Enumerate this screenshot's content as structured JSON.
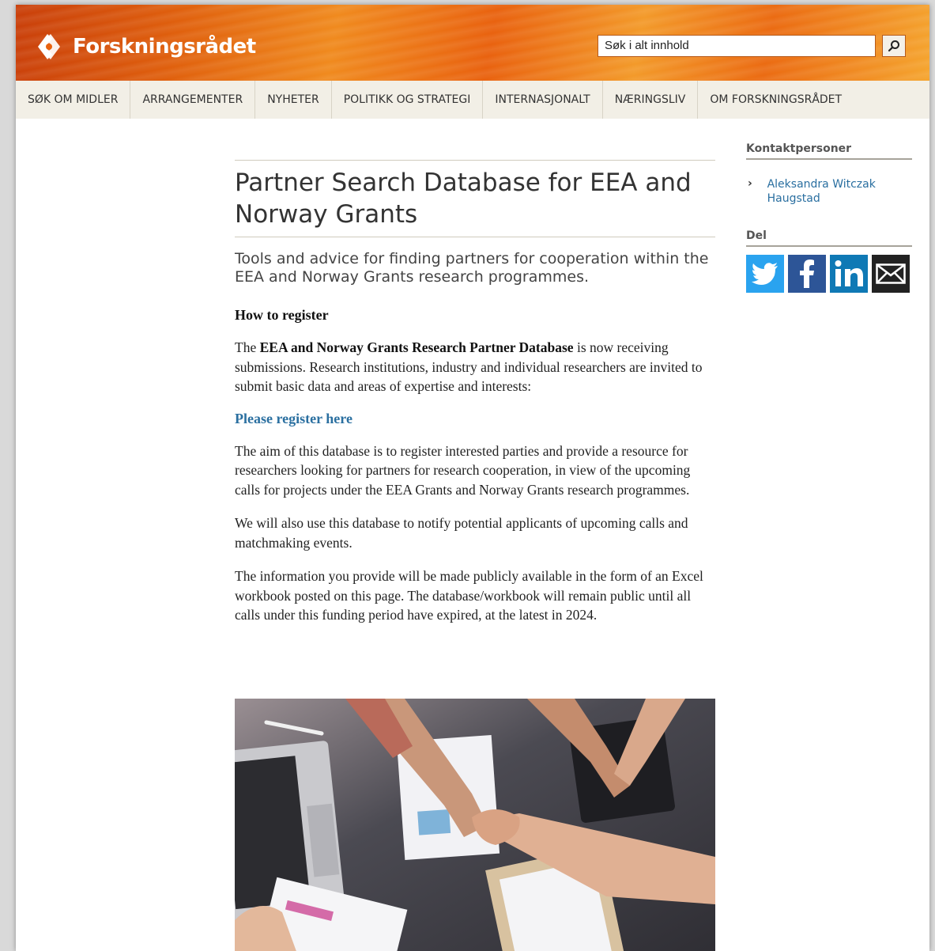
{
  "header": {
    "brand_name": "Forskningsrådet",
    "search_placeholder": "Søk i alt innhold",
    "colors": {
      "header_orange": "#e9620f",
      "link_blue": "#2a6fa0"
    }
  },
  "nav": {
    "items": [
      {
        "label": "SØK OM MIDLER"
      },
      {
        "label": "ARRANGEMENTER"
      },
      {
        "label": "NYHETER"
      },
      {
        "label": "POLITIKK OG STRATEGI"
      },
      {
        "label": "INTERNASJONALT"
      },
      {
        "label": "NÆRINGSLIV"
      },
      {
        "label": "OM FORSKNINGSRÅDET"
      }
    ]
  },
  "article": {
    "title": "Partner Search Database for EEA and Norway Grants",
    "lead": "Tools and advice for finding partners for cooperation within the EEA and Norway Grants research programmes.",
    "subheading": "How to register",
    "p1_start": "The ",
    "p1_bold": "EEA and Norway Grants Research Partner Database",
    "p1_end": " is now receiving submissions. Research institutions, industry and individual researchers are invited to submit basic data and areas of expertise and interests:",
    "register_link": "Please register here",
    "p2": "The aim of this database is to register interested parties and provide a resource for researchers looking for partners for research cooperation, in view of the upcoming calls for projects under the EEA Grants and Norway Grants research programmes.",
    "p3": "We will also use this database to notify potential applicants of upcoming calls and matchmaking events.",
    "p4": "The information you provide will be made publicly available in the form of an Excel workbook posted on this page. The database/workbook will remain public until all calls under this funding period have expired, at the latest in 2024."
  },
  "sidebar": {
    "contacts_heading": "Kontaktpersoner",
    "contact_name": "Aleksandra Witczak Haugstad",
    "share_heading": "Del",
    "share_icons": [
      "twitter-icon",
      "facebook-icon",
      "linkedin-icon",
      "email-icon"
    ]
  }
}
